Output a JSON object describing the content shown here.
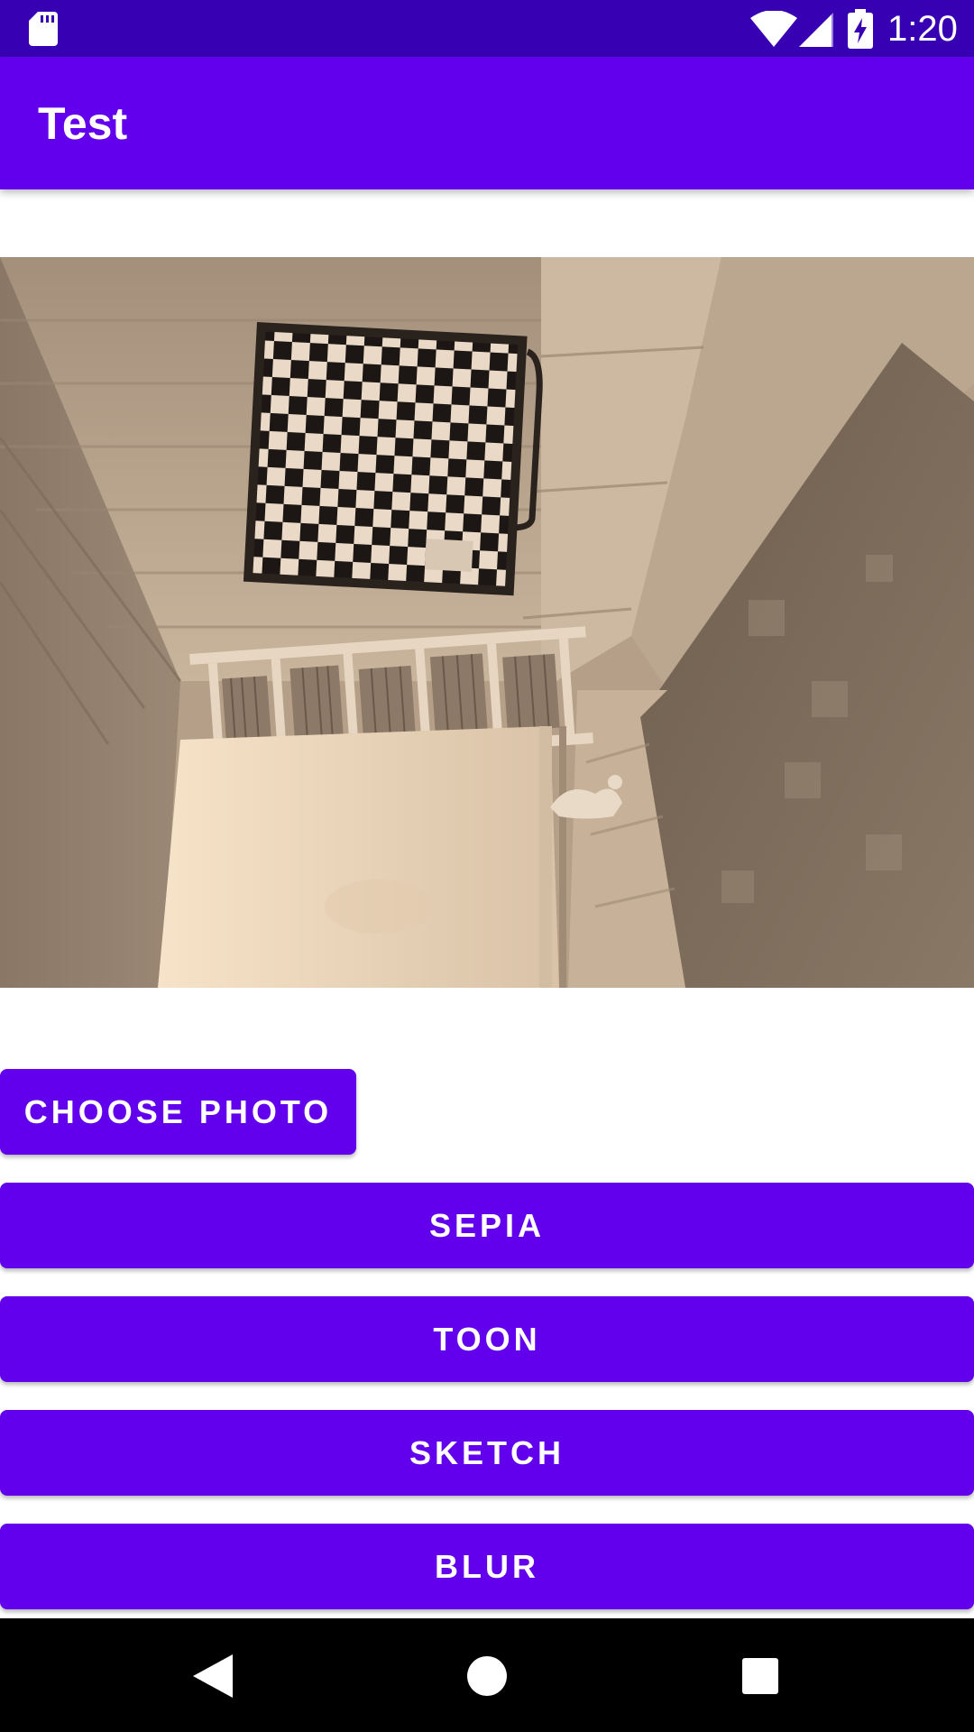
{
  "status_bar": {
    "time": "1:20",
    "icons": [
      "sd-card-icon",
      "wifi-icon",
      "cellular-signal-icon",
      "battery-charging-icon"
    ]
  },
  "app_bar": {
    "title": "Test"
  },
  "photo": {
    "description_icon": "filtered-photo-image",
    "tone_colors": {
      "light": "#f2dcc4",
      "mid": "#c3ae96",
      "dark": "#6d5d4d"
    }
  },
  "buttons": {
    "choose_photo": "CHOOSE PHOTO",
    "sepia": "SEPIA",
    "toon": "TOON",
    "sketch": "SKETCH",
    "blur": "BLUR"
  },
  "colors": {
    "primary": "#6200ee",
    "primary_dark": "#3700b3",
    "on_primary": "#ffffff",
    "nav_background": "#000000"
  },
  "nav_bar": {
    "icons": [
      "back-icon",
      "home-icon",
      "recents-icon"
    ]
  }
}
